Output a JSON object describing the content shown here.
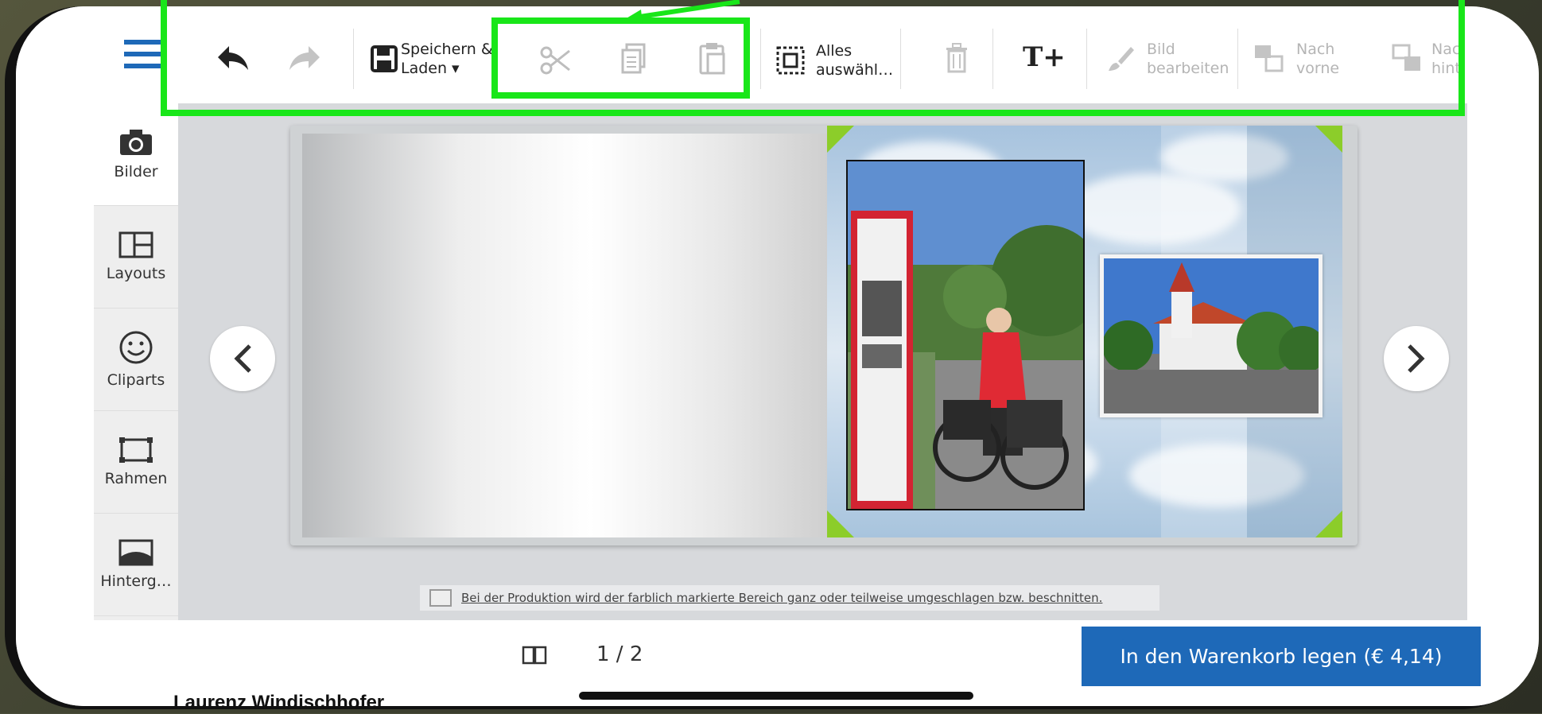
{
  "toolbar": {
    "menu_icon": "hamburger-icon",
    "undo_icon": "undo-icon",
    "redo_icon": "redo-icon",
    "save_label_line1": "Speichern &",
    "save_label_line2": "Laden ▾",
    "cut_icon": "scissors-icon",
    "copy_icon": "copy-icon",
    "paste_icon": "paste-icon",
    "select_all_line1": "Alles",
    "select_all_line2": "auswähl…",
    "delete_icon": "trash-icon",
    "add_text_label": "T+",
    "edit_image_line1": "Bild",
    "edit_image_line2": "bearbeiten",
    "bring_forward_line1": "Nach",
    "bring_forward_line2": "vorne",
    "send_back_line1": "Nac",
    "send_back_line2": "hint"
  },
  "sidebar": {
    "items": [
      {
        "label": "Bilder",
        "icon": "camera-icon"
      },
      {
        "label": "Layouts",
        "icon": "layout-icon"
      },
      {
        "label": "Cliparts",
        "icon": "smiley-icon"
      },
      {
        "label": "Rahmen",
        "icon": "frame-icon"
      },
      {
        "label": "Hinterg…",
        "icon": "background-icon"
      }
    ]
  },
  "canvas": {
    "notice": "Bei der Produktion wird der farblich markierte Bereich ganz oder teilweise umgeschlagen bzw. beschnitten."
  },
  "footer": {
    "page_indicator": "1 / 2",
    "cart_button": "In den Warenkorb legen (€ 4,14)"
  },
  "overlay": {
    "author": "Laurenz Windischhofer"
  },
  "colors": {
    "highlight": "#19e619",
    "cart_bg": "#1e69b8",
    "menu_blue": "#1e69b8"
  }
}
